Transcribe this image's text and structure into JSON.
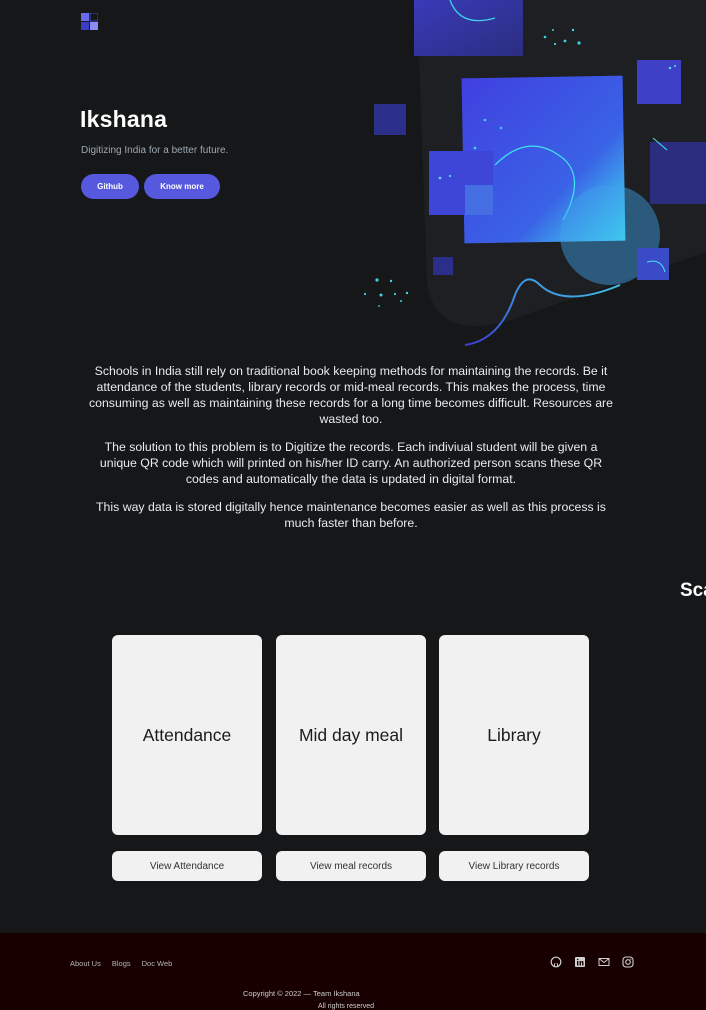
{
  "header": {
    "logo_icon": "grid-logo-icon",
    "title": "Ikshana",
    "subtitle": "Digitizing India for a better future.",
    "buttons": {
      "github": "Github",
      "know_more": "Know more"
    },
    "accent_color": "#5658dd"
  },
  "about": {
    "paragraphs": [
      "Schools in India still rely on traditional book keeping methods for maintaining the records. Be it attendance of the students, library records or mid-meal records. This makes the process, time consuming as well as maintaining these records for a long time becomes difficult. Resources are wasted too.",
      "The solution to this problem is to Digitize the records. Each indiviual student will be given a unique QR code which will printed on his/her ID carry. An authorized person scans these QR codes and automatically the data is updated in digital format.",
      "This way data is stored digitally hence maintenance becomes easier as well as this process is much faster than before."
    ],
    "cut_off_heading": "Sca"
  },
  "cards": [
    {
      "title": "Attendance",
      "button": "View Attendance"
    },
    {
      "title": "Mid day meal",
      "button": "View meal records"
    },
    {
      "title": "Library",
      "button": "View Library records"
    }
  ],
  "footer": {
    "links": [
      "About Us",
      "Blogs",
      "Doc Web"
    ],
    "icons": [
      "github-icon",
      "linkedin-icon",
      "mail-icon",
      "instagram-icon"
    ],
    "copyright": "Copyright © 2022 — Team Ikshana",
    "rights": "All rights reserved"
  }
}
